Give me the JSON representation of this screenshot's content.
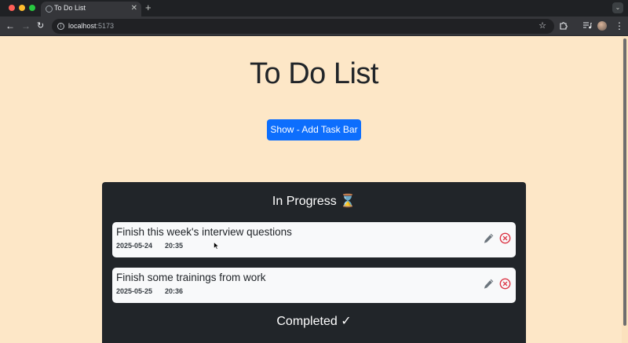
{
  "browser": {
    "tab_title": "To Do List",
    "new_tab": "+",
    "url_host": "localhost",
    "url_port": ":5173",
    "traffic_colors": [
      "#ff5f57",
      "#febc2e",
      "#28c840"
    ]
  },
  "page": {
    "title": "To Do List",
    "show_button_label": "Show - Add Task Bar",
    "in_progress_title": "In Progress ⌛",
    "completed_title": "Completed ✓",
    "tasks": [
      {
        "name": "Finish this week's interview questions",
        "date": "2025-05-24",
        "time": "20:35"
      },
      {
        "name": "Finish some trainings from work",
        "date": "2025-05-25",
        "time": "20:36"
      }
    ],
    "colors": {
      "background": "#fde7c7",
      "button": "#0d6efd",
      "panel": "#212529",
      "delete": "#dc3545"
    }
  }
}
